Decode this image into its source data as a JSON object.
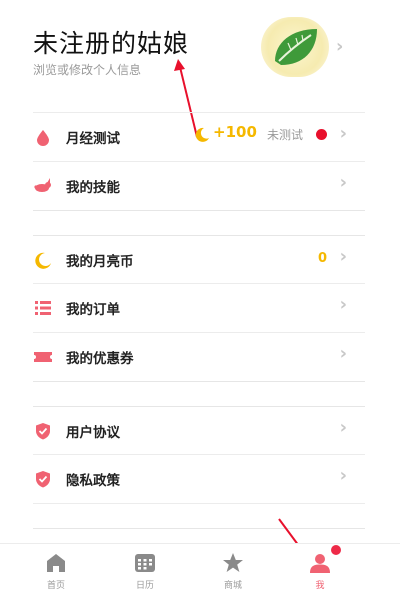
{
  "profile": {
    "name": "未注册的姑娘",
    "subtitle": "浏览或修改个人信息"
  },
  "menu": {
    "period_test": {
      "label": "月经测试",
      "points": "+100",
      "status": "未测试"
    },
    "skills": {
      "label": "我的技能"
    },
    "moon_coins": {
      "label": "我的月亮币",
      "value": "0"
    },
    "orders": {
      "label": "我的订单"
    },
    "coupons": {
      "label": "我的优惠券"
    },
    "agreement": {
      "label": "用户协议"
    },
    "privacy": {
      "label": "隐私政策"
    }
  },
  "tabs": [
    {
      "label": "首页",
      "icon": "home-icon"
    },
    {
      "label": "日历",
      "icon": "calendar-icon"
    },
    {
      "label": "商城",
      "icon": "star-icon"
    },
    {
      "label": "我",
      "icon": "person-icon",
      "active": true
    }
  ],
  "colors": {
    "accent_pink": "#f06272",
    "gold": "#f5b800",
    "red_dot": "#e8102c",
    "annotation_red": "#e8102c"
  }
}
